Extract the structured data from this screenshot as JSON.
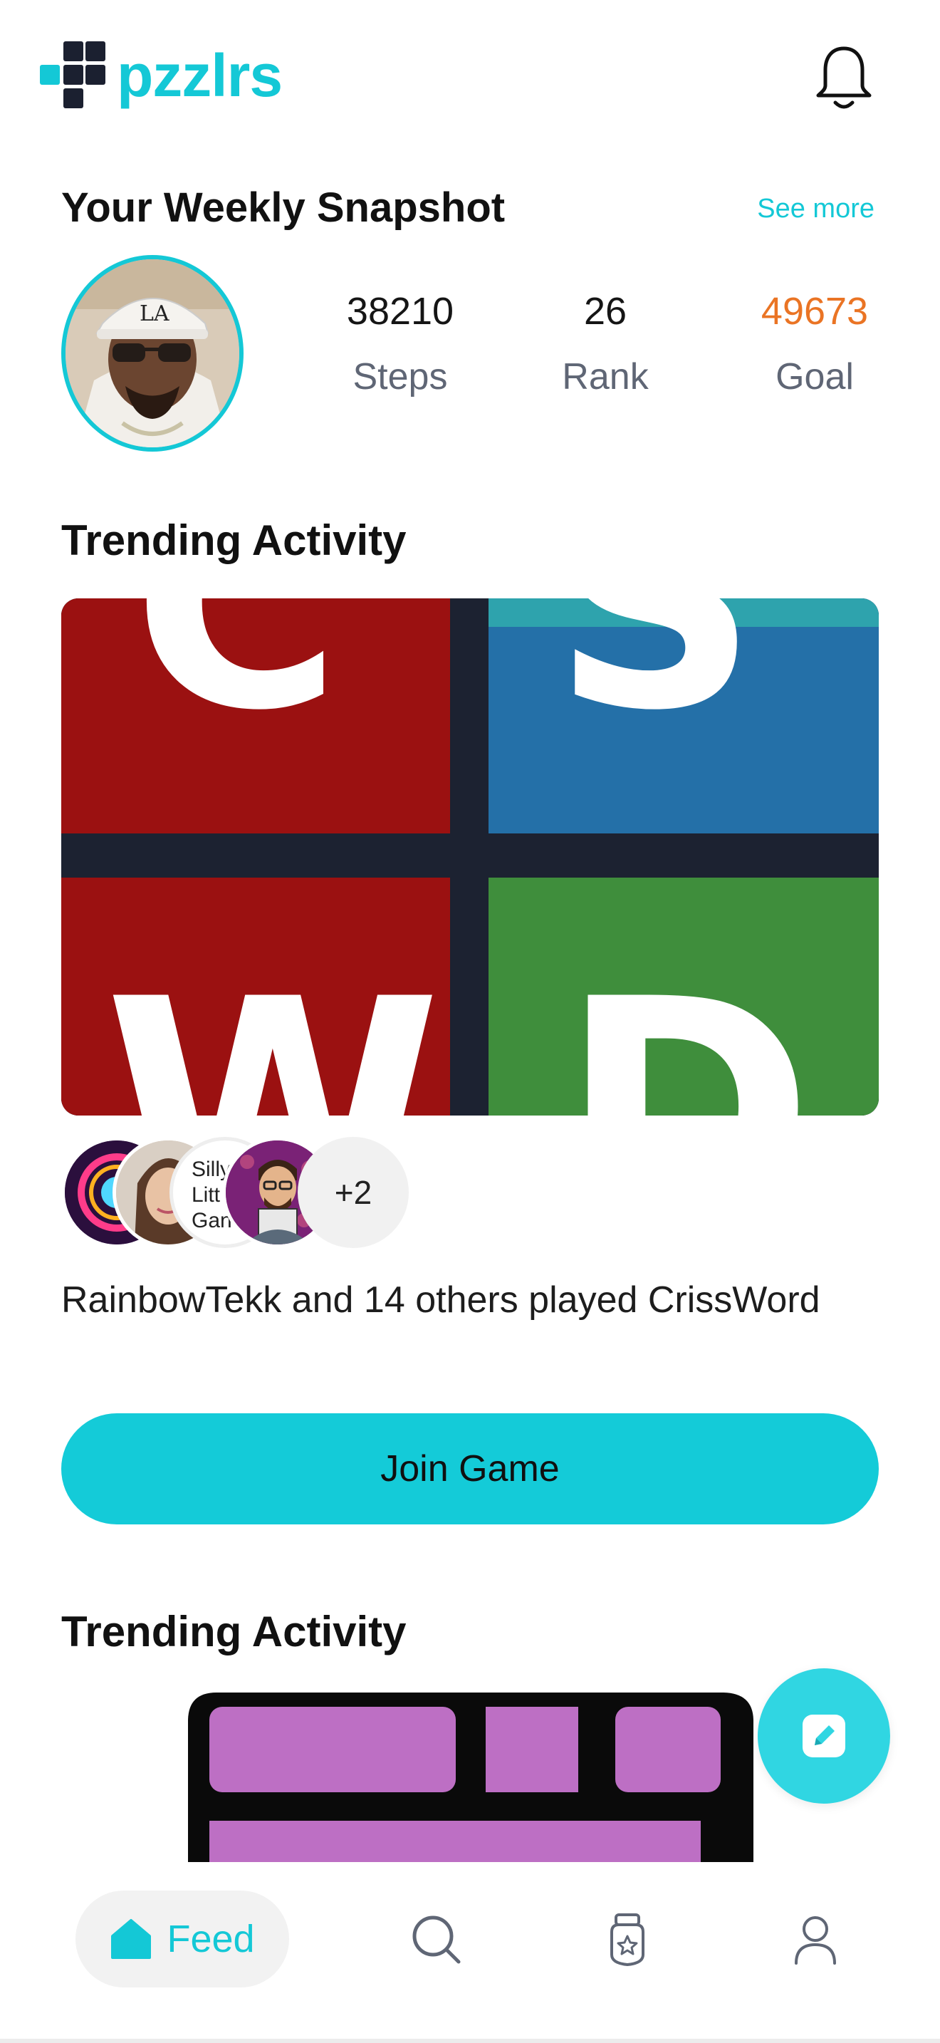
{
  "header": {
    "app_name": "pzzlrs",
    "notifications_icon": "bell-icon"
  },
  "snapshot": {
    "title": "Your Weekly Snapshot",
    "see_more": "See more",
    "stats": [
      {
        "value": "38210",
        "label": "Steps"
      },
      {
        "value": "26",
        "label": "Rank"
      },
      {
        "value": "49673",
        "label": "Goal"
      }
    ]
  },
  "trending": [
    {
      "title": "Trending Activity",
      "tile_letters": [
        "C",
        "S",
        "W",
        "D"
      ],
      "more_count": "+2",
      "silly_avatar_text": [
        "Silly",
        "Litt",
        "Gan"
      ],
      "description": "RainbowTekk and 14 others played CrissWord",
      "join_label": "Join Game"
    },
    {
      "title": "Trending Activity"
    }
  ],
  "fab": {
    "icon": "edit-pencil-icon"
  },
  "nav": {
    "feed_label": "Feed",
    "items": [
      "home-icon",
      "search-icon",
      "badge-icon",
      "profile-icon"
    ]
  },
  "colors": {
    "accent": "#14c8d6",
    "goal": "#ea7424",
    "tile_red": "#9b1111",
    "tile_blue": "#2470a8",
    "tile_green": "#3f8e3c",
    "tile_purple": "#bd6fc4"
  }
}
